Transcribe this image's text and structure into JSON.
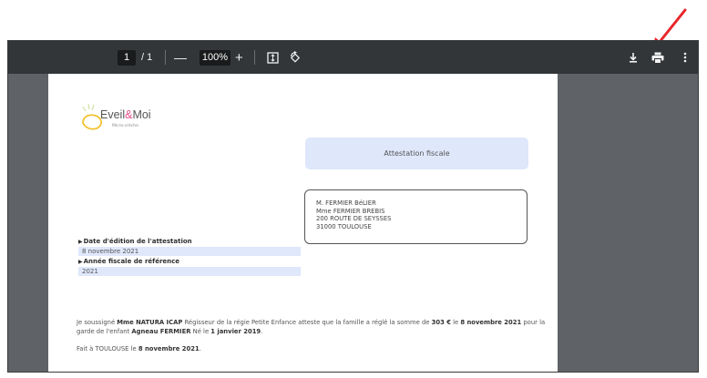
{
  "toolbar": {
    "page_current": "1",
    "page_total": "/ 1",
    "zoom_minus": "—",
    "zoom_value": "100%",
    "zoom_plus": "+",
    "icons": [
      "zoom-out-icon",
      "zoom-in-icon",
      "fit-page-icon",
      "rotate-icon",
      "download-icon",
      "print-icon",
      "more-options-icon"
    ]
  },
  "document": {
    "logo": {
      "name_part1": "Eveil",
      "name_amp": "&",
      "name_part2": "Moi",
      "subtitle": "Micro-crèche"
    },
    "title": "Attestation fiscale",
    "address": {
      "line1": "M. FERMIER BéLIER",
      "line2": "Mme FERMIER BREBIS",
      "line3": "200 ROUTE DE SEYSSES",
      "line4": "31000 TOULOUSE"
    },
    "date_label": "Date d'édition de l'attestation",
    "date_value": "8 novembre 2021",
    "year_label": "Année fiscale de référence",
    "year_value": "2021",
    "body": {
      "t1": "Je soussigné ",
      "signatory": "Mme NATURA ICAP",
      "t2": " Régisseur de la régie Petite Enfance atteste que la famille a réglé la somme de ",
      "amount": "303 €",
      "t3": " le ",
      "pay_date": "8 novembre 2021",
      "t4": " pour la garde de l'enfant ",
      "child": "Agneau FERMIER",
      "t5": " Né le ",
      "birth": "1 janvier 2019",
      "t6": "."
    },
    "footer": {
      "t1": "Fait à TOULOUSE le ",
      "date": "8 novembre 2021",
      "t2": "."
    }
  },
  "colors": {
    "toolbar": "#323639",
    "viewer_bg": "#525659",
    "highlight": "#dfe7fb",
    "annotation_arrow": "#e8262b"
  }
}
